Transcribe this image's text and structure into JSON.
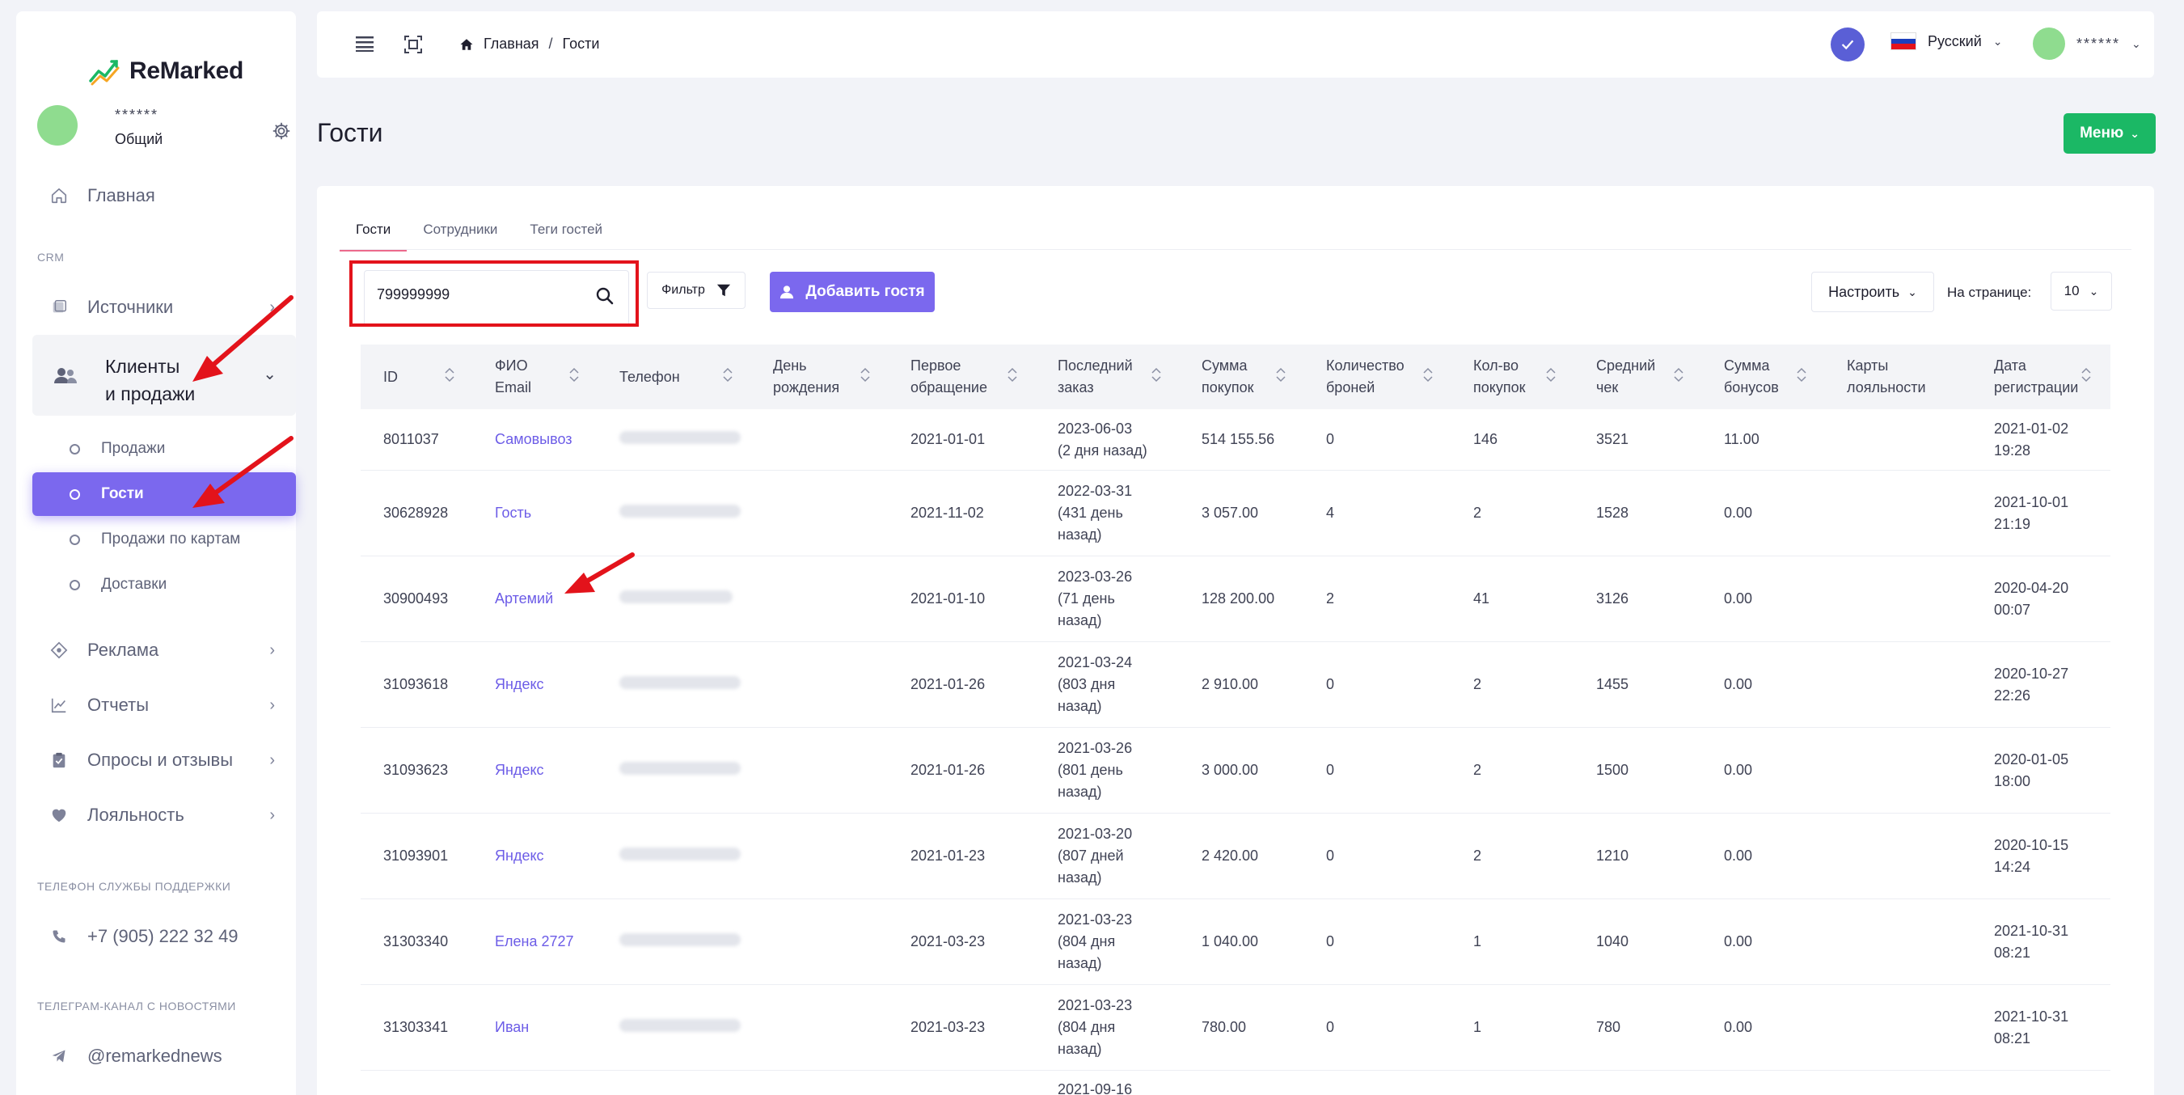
{
  "app": {
    "name": "ReMarked"
  },
  "sidebar": {
    "user": {
      "name": "******",
      "role": "Общий"
    },
    "crm_caption": "CRM",
    "items": [
      {
        "label": "Главная",
        "icon": "home-icon"
      },
      {
        "label": "Источники",
        "icon": "sources-icon"
      },
      {
        "label": "Клиенты\nи продажи",
        "icon": "users-icon"
      },
      {
        "label": "Реклама",
        "icon": "target-icon"
      },
      {
        "label": "Отчеты",
        "icon": "chart-icon"
      },
      {
        "label": "Опросы и отзывы",
        "icon": "clipboard-icon"
      },
      {
        "label": "Лояльность",
        "icon": "heart-icon"
      }
    ],
    "group_line1": "Клиенты",
    "group_line2": "и продажи",
    "subitems": [
      {
        "label": "Продажи"
      },
      {
        "label": "Гости"
      },
      {
        "label": "Продажи по картам"
      },
      {
        "label": "Доставки"
      }
    ],
    "support_caption": "ТЕЛЕФОН СЛУЖБЫ ПОДДЕРЖКИ",
    "support_phone": "+7 (905) 222 32 49",
    "telegram_caption": "ТЕЛЕГРАМ-КАНАЛ С НОВОСТЯМИ",
    "telegram_handle": "@remarkednews"
  },
  "header": {
    "breadcrumb_home": "Главная",
    "breadcrumb_sep": "/",
    "breadcrumb_current": "Гости",
    "language": "Русский",
    "account_name": "******"
  },
  "page": {
    "title": "Гости",
    "menu_label": "Меню"
  },
  "tabs": [
    {
      "label": "Гости"
    },
    {
      "label": "Сотрудники"
    },
    {
      "label": "Теги гостей"
    }
  ],
  "toolbar": {
    "search_value": "799999999",
    "filter_label": "Фильтр",
    "add_guest_label": "Добавить гостя",
    "configure_label": "Настроить",
    "per_page_label": "На странице:",
    "per_page_value": "10"
  },
  "table": {
    "columns": [
      {
        "l1": "ID",
        "l2": ""
      },
      {
        "l1": "ФИО",
        "l2": "Email"
      },
      {
        "l1": "Телефон",
        "l2": ""
      },
      {
        "l1": "День",
        "l2": "рождения"
      },
      {
        "l1": "Первое",
        "l2": "обращение"
      },
      {
        "l1": "Последний",
        "l2": "заказ"
      },
      {
        "l1": "Сумма",
        "l2": "покупок"
      },
      {
        "l1": "Количество",
        "l2": "броней"
      },
      {
        "l1": "Кол-во",
        "l2": "покупок"
      },
      {
        "l1": "Средний",
        "l2": "чек"
      },
      {
        "l1": "Сумма",
        "l2": "бонусов"
      },
      {
        "l1": "Карты",
        "l2": "лояльности"
      },
      {
        "l1": "Дата",
        "l2": "регистрации"
      }
    ],
    "rows": [
      {
        "id": "8011037",
        "name": "Самовывоз",
        "birthday": "",
        "first": "2021-01-01",
        "last": [
          "2023-06-03",
          "(2 дня назад)"
        ],
        "sum": "514 155.56",
        "bookings": "0",
        "purchases": "146",
        "avg": "3521",
        "bonus": "11.00",
        "cards": "",
        "reg": [
          "2021-01-02",
          "19:28"
        ]
      },
      {
        "id": "30628928",
        "name": "Гость",
        "birthday": "",
        "first": "2021-11-02",
        "last": [
          "2022-03-31",
          "(431 день",
          "назад)"
        ],
        "sum": "3 057.00",
        "bookings": "4",
        "purchases": "2",
        "avg": "1528",
        "bonus": "0.00",
        "cards": "",
        "reg": [
          "2021-10-01",
          "21:19"
        ]
      },
      {
        "id": "30900493",
        "name": "Артемий",
        "birthday": "",
        "first": "2021-01-10",
        "last": [
          "2023-03-26",
          "(71 день",
          "назад)"
        ],
        "sum": "128 200.00",
        "bookings": "2",
        "purchases": "41",
        "avg": "3126",
        "bonus": "0.00",
        "cards": "",
        "reg": [
          "2020-04-20",
          "00:07"
        ]
      },
      {
        "id": "31093618",
        "name": "Яндекс",
        "birthday": "",
        "first": "2021-01-26",
        "last": [
          "2021-03-24",
          "(803 дня",
          "назад)"
        ],
        "sum": "2 910.00",
        "bookings": "0",
        "purchases": "2",
        "avg": "1455",
        "bonus": "0.00",
        "cards": "",
        "reg": [
          "2020-10-27",
          "22:26"
        ]
      },
      {
        "id": "31093623",
        "name": "Яндекс",
        "birthday": "",
        "first": "2021-01-26",
        "last": [
          "2021-03-26",
          "(801 день",
          "назад)"
        ],
        "sum": "3 000.00",
        "bookings": "0",
        "purchases": "2",
        "avg": "1500",
        "bonus": "0.00",
        "cards": "",
        "reg": [
          "2020-01-05",
          "18:00"
        ]
      },
      {
        "id": "31093901",
        "name": "Яндекс",
        "birthday": "",
        "first": "2021-01-23",
        "last": [
          "2021-03-20",
          "(807 дней",
          "назад)"
        ],
        "sum": "2 420.00",
        "bookings": "0",
        "purchases": "2",
        "avg": "1210",
        "bonus": "0.00",
        "cards": "",
        "reg": [
          "2020-10-15",
          "14:24"
        ]
      },
      {
        "id": "31303340",
        "name": "Елена 2727",
        "birthday": "",
        "first": "2021-03-23",
        "last": [
          "2021-03-23",
          "(804 дня",
          "назад)"
        ],
        "sum": "1 040.00",
        "bookings": "0",
        "purchases": "1",
        "avg": "1040",
        "bonus": "0.00",
        "cards": "",
        "reg": [
          "2021-10-31",
          "08:21"
        ]
      },
      {
        "id": "31303341",
        "name": "Иван",
        "birthday": "",
        "first": "2021-03-23",
        "last": [
          "2021-03-23",
          "(804 дня",
          "назад)"
        ],
        "sum": "780.00",
        "bookings": "0",
        "purchases": "1",
        "avg": "780",
        "bonus": "0.00",
        "cards": "",
        "reg": [
          "2021-10-31",
          "08:21"
        ]
      },
      {
        "id": "",
        "name": "",
        "birthday": "",
        "first": "",
        "last": [
          "2021-09-16"
        ],
        "sum": "",
        "bookings": "",
        "purchases": "",
        "avg": "",
        "bonus": "",
        "cards": "",
        "reg": [
          ""
        ]
      }
    ]
  },
  "colors": {
    "accent_purple": "#7b68ee",
    "menu_green": "#1bb865",
    "highlight_red": "#e3131b",
    "link": "#6c5ce7"
  }
}
